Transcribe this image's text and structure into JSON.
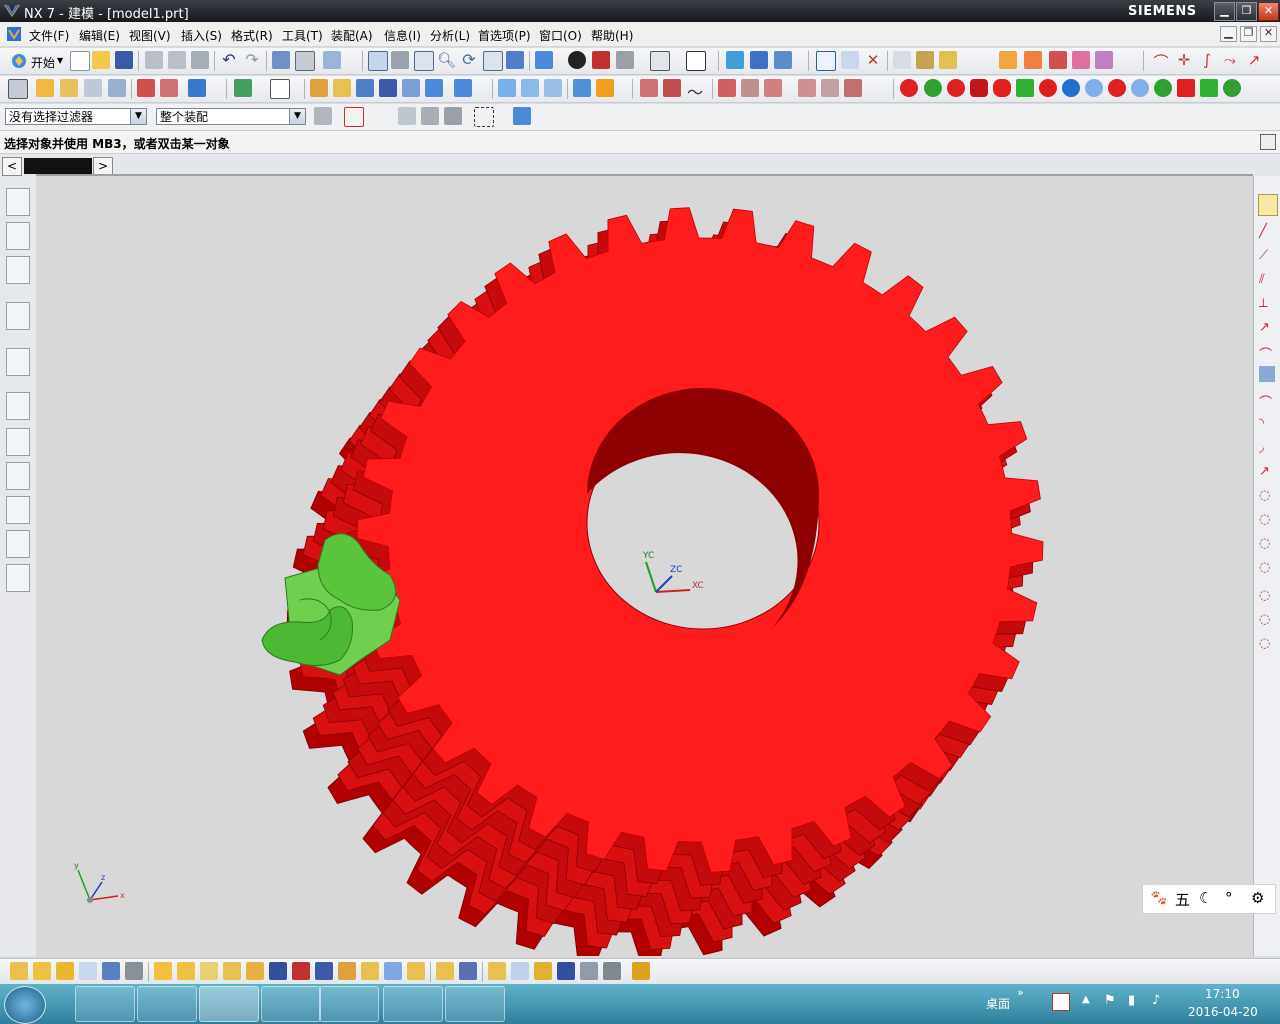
{
  "window": {
    "title": "NX 7 - 建模 - [model1.prt]",
    "brand": "SIEMENS"
  },
  "menu": [
    "文件(F)",
    "编辑(E)",
    "视图(V)",
    "插入(S)",
    "格式(R)",
    "工具(T)",
    "装配(A)",
    "信息(I)",
    "分析(L)",
    "首选项(P)",
    "窗口(O)",
    "帮助(H)"
  ],
  "toolbar": {
    "start_label": "开始"
  },
  "selection": {
    "filter_value": "没有选择过滤器",
    "scope_value": "整个装配"
  },
  "cue_line": "选择对象并使用 MB3，或者双击某一对象",
  "wcs": {
    "x": "XC",
    "y": "YC",
    "z": "ZC"
  },
  "triad": {
    "x": "x",
    "y": "y",
    "z": "z"
  },
  "ime": {
    "mode": "五"
  },
  "taskbar": {
    "desktop_label": "桌面",
    "time": "17:10",
    "date": "2016-04-20"
  },
  "colors": {
    "gear": "#ff1c1c",
    "gear_shadow": "#b00000",
    "worm": "#5ac53c",
    "viewport_bg": "#d8d8d8"
  }
}
